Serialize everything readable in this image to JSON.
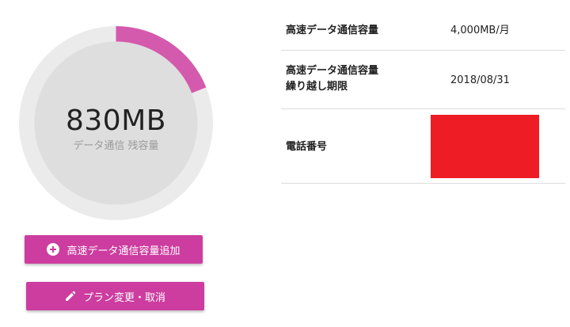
{
  "gauge": {
    "value_label": "830MB",
    "caption": "データ通信 残容量",
    "fill_fraction": 0.19,
    "colors": {
      "track": "#ebebeb",
      "inner": "#dedede",
      "fill": "#d45aad"
    }
  },
  "buttons": {
    "add_capacity": {
      "label": "高速データ通信容量追加",
      "icon": "plus-circle-icon"
    },
    "change_plan": {
      "label": "プラン変更・取消",
      "icon": "pencil-icon"
    },
    "color": "#cc3d9f"
  },
  "info_table": {
    "rows": [
      {
        "label": "高速データ通信容量",
        "value": "4,000MB/月"
      },
      {
        "label_line1": "高速データ通信容量",
        "label_line2": "繰り越し期限",
        "value": "2018/08/31"
      },
      {
        "label": "電話番号",
        "redaction_color": "#ee1c25"
      }
    ]
  }
}
